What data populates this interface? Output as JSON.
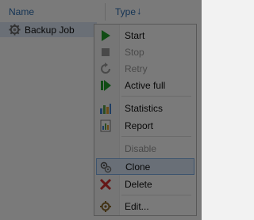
{
  "columns": {
    "name": "Name",
    "type": "Type",
    "sort_arrow": "↓"
  },
  "row": {
    "label": "Backup Job",
    "icon": "backup-job-gear-icon"
  },
  "menu": {
    "items": [
      {
        "label": "Start",
        "icon": "start-icon",
        "enabled": true
      },
      {
        "label": "Stop",
        "icon": "stop-icon",
        "enabled": false
      },
      {
        "label": "Retry",
        "icon": "retry-icon",
        "enabled": false
      },
      {
        "label": "Active full",
        "icon": "active-full-icon",
        "enabled": true
      },
      {
        "label": "Statistics",
        "icon": "statistics-icon",
        "enabled": true
      },
      {
        "label": "Report",
        "icon": "report-icon",
        "enabled": true
      },
      {
        "label": "Disable",
        "icon": "",
        "enabled": false
      },
      {
        "label": "Clone",
        "icon": "clone-icon",
        "enabled": true,
        "selected": true
      },
      {
        "label": "Delete",
        "icon": "delete-icon",
        "enabled": true
      },
      {
        "label": "Edit...",
        "icon": "edit-icon",
        "enabled": true
      }
    ]
  },
  "colors": {
    "accent": "#2b6cb0",
    "selection": "#dce9f8",
    "start_green": "#22a02b",
    "delete_red": "#d32f2f"
  }
}
